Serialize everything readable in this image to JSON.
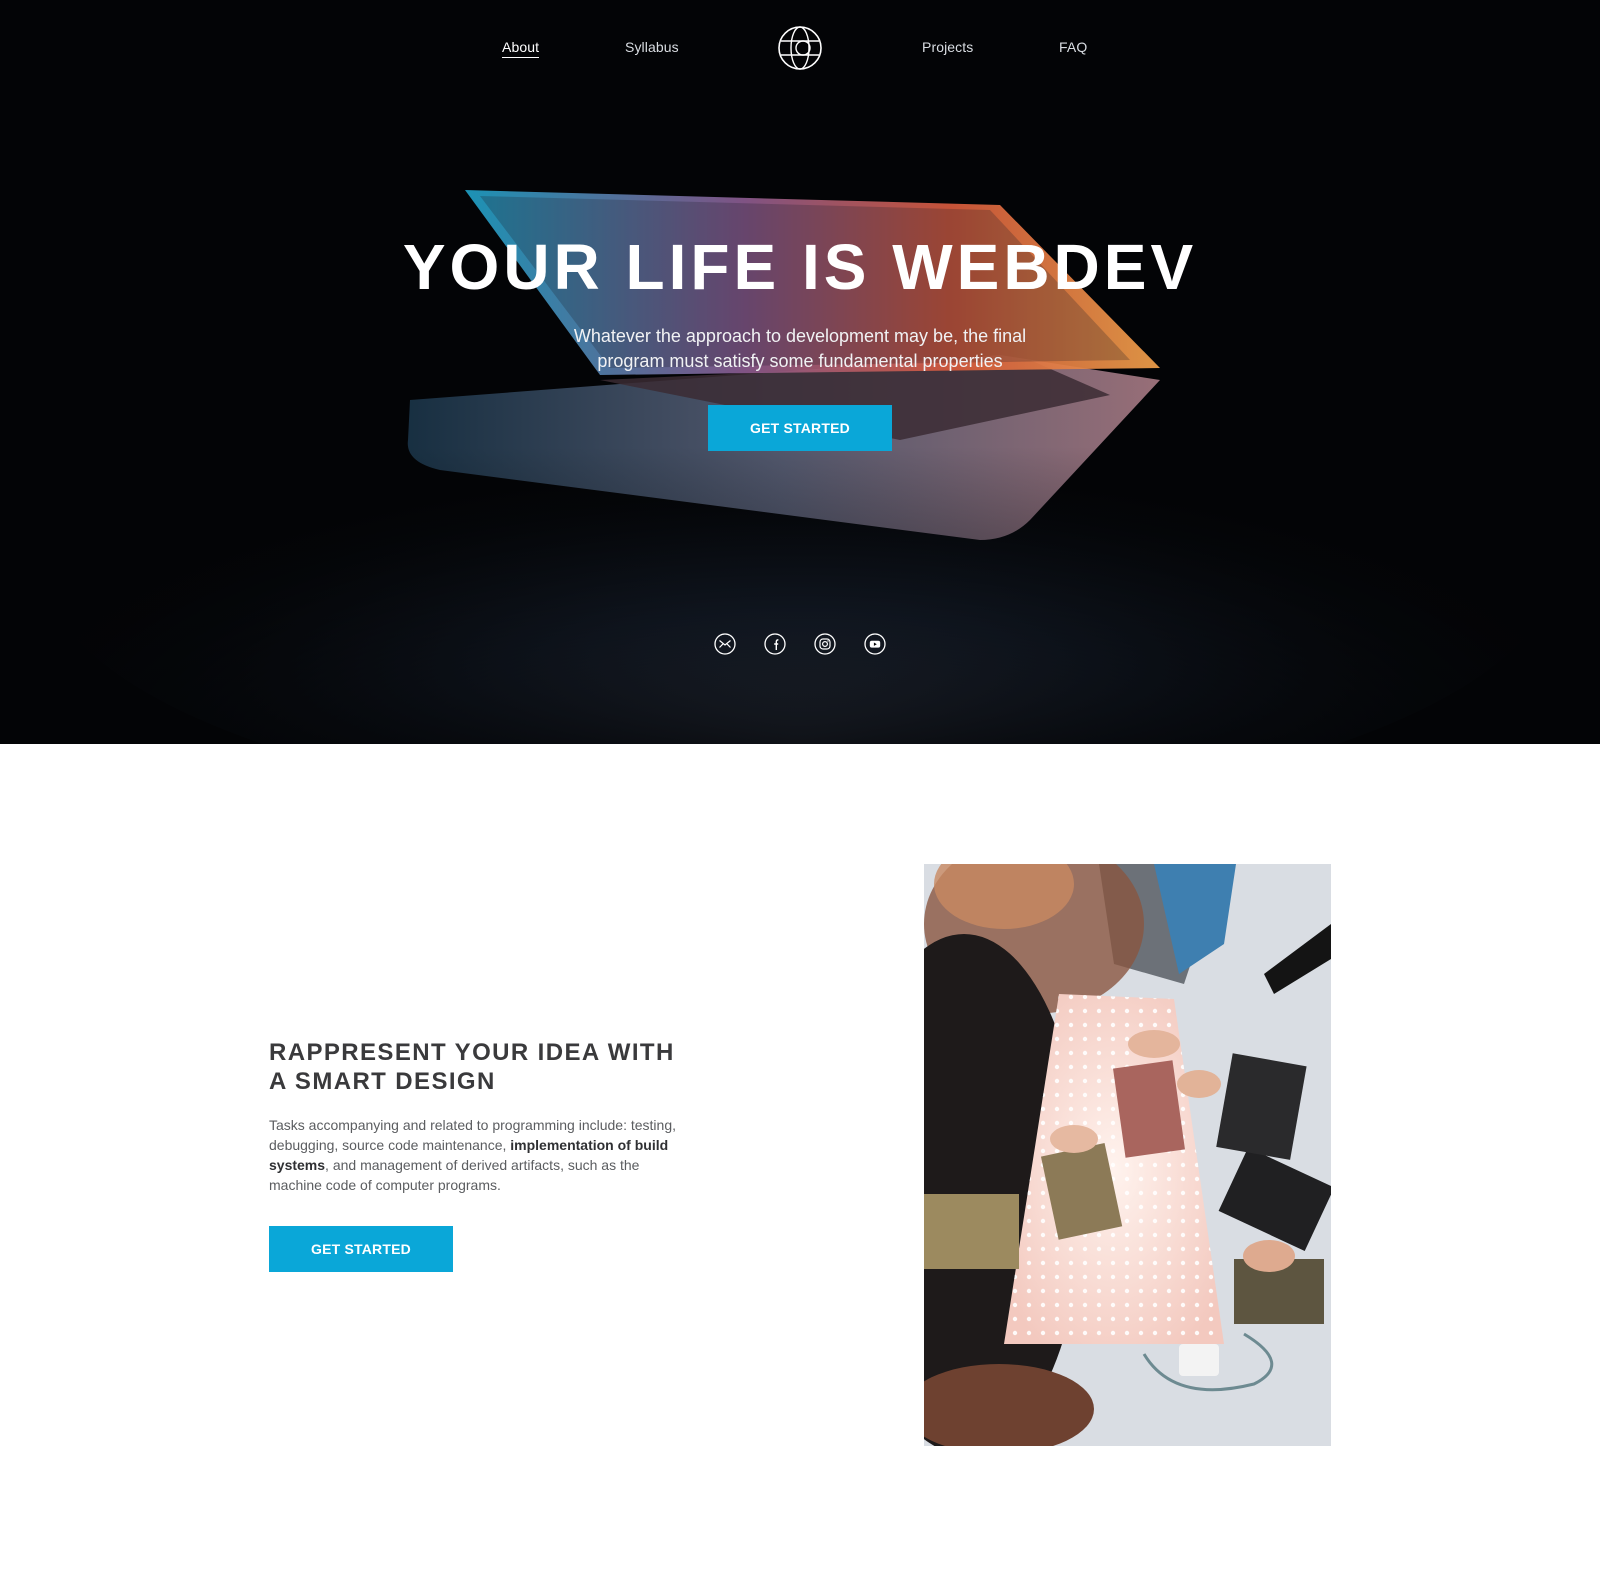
{
  "nav": {
    "about": "About",
    "syllabus": "Syllabus",
    "projects": "Projects",
    "faq": "FAQ",
    "logo_icon": "globe-icon"
  },
  "hero": {
    "title": "YOUR LIFE IS WEBDEV",
    "subtitle": "Whatever the approach to development may be, the final program must satisfy some fundamental properties",
    "cta_label": "GET STARTED",
    "background": "laptop-photo",
    "social_icons": [
      "mail-icon",
      "facebook-icon",
      "instagram-icon",
      "youtube-icon"
    ]
  },
  "feature": {
    "title_line1": "RAPPRESENT YOUR IDEA WITH",
    "title_line2": "A SMART DESIGN",
    "text_part1": "Tasks accompanying and related to programming include: testing, debugging, source code maintenance, ",
    "text_bold": "implementation of build systems",
    "text_part2": ", and management of derived artifacts, such as the machine code of computer programs.",
    "cta_label": "GET STARTED",
    "image": "team-workshop-photo"
  },
  "colors": {
    "accent": "#0aa7d8",
    "hero_bg": "#030406",
    "heading_text": "#3a3a3c",
    "body_text": "#5b5d60"
  }
}
